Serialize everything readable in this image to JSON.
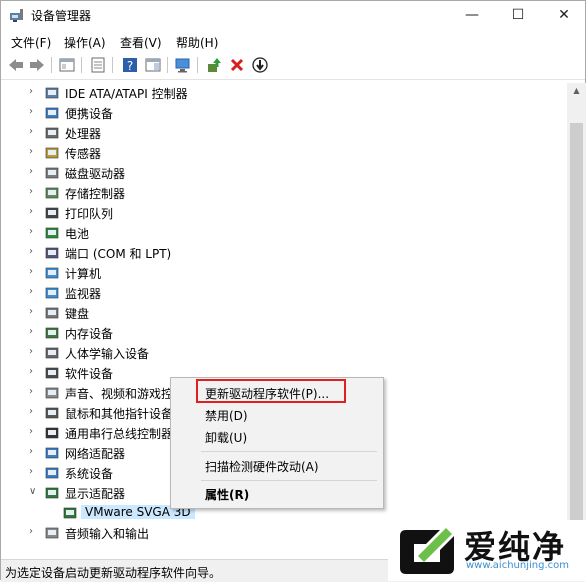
{
  "window": {
    "title": "设备管理器",
    "minimize": "—",
    "maximize": "☐",
    "close": "✕"
  },
  "menu": [
    "文件(F)",
    "操作(A)",
    "查看(V)",
    "帮助(H)"
  ],
  "tree": [
    {
      "label": "IDE ATA/ATAPI 控制器",
      "icon": "ide-controller-icon",
      "expanded": false
    },
    {
      "label": "便携设备",
      "icon": "portable-device-icon",
      "expanded": false
    },
    {
      "label": "处理器",
      "icon": "processor-icon",
      "expanded": false
    },
    {
      "label": "传感器",
      "icon": "sensor-icon",
      "expanded": false
    },
    {
      "label": "磁盘驱动器",
      "icon": "disk-drive-icon",
      "expanded": false
    },
    {
      "label": "存储控制器",
      "icon": "storage-controller-icon",
      "expanded": false
    },
    {
      "label": "打印队列",
      "icon": "printer-icon",
      "expanded": false
    },
    {
      "label": "电池",
      "icon": "battery-icon",
      "expanded": false
    },
    {
      "label": "端口 (COM 和 LPT)",
      "icon": "port-icon",
      "expanded": false
    },
    {
      "label": "计算机",
      "icon": "computer-icon",
      "expanded": false
    },
    {
      "label": "监视器",
      "icon": "monitor-icon",
      "expanded": false
    },
    {
      "label": "键盘",
      "icon": "keyboard-icon",
      "expanded": false
    },
    {
      "label": "内存设备",
      "icon": "memory-icon",
      "expanded": false
    },
    {
      "label": "人体学输入设备",
      "icon": "hid-icon",
      "expanded": false
    },
    {
      "label": "软件设备",
      "icon": "software-device-icon",
      "expanded": false
    },
    {
      "label": "声音、视频和游戏控",
      "icon": "sound-icon",
      "expanded": false
    },
    {
      "label": "鼠标和其他指针设备",
      "icon": "mouse-icon",
      "expanded": false
    },
    {
      "label": "通用串行总线控制器",
      "icon": "usb-icon",
      "expanded": false
    },
    {
      "label": "网络适配器",
      "icon": "network-adapter-icon",
      "expanded": false
    },
    {
      "label": "系统设备",
      "icon": "system-device-icon",
      "expanded": false
    },
    {
      "label": "显示适配器",
      "icon": "display-adapter-icon",
      "expanded": true
    },
    {
      "label": "VMware SVGA 3D",
      "icon": "display-adapter-icon",
      "child": true,
      "selected": true
    },
    {
      "label": "音频输入和输出",
      "icon": "audio-io-icon",
      "expanded": false
    }
  ],
  "context_menu": {
    "update_driver": "更新驱动程序软件(P)...",
    "disable": "禁用(D)",
    "uninstall": "卸载(U)",
    "scan": "扫描检测硬件改动(A)",
    "properties": "属性(R)"
  },
  "status": "为选定设备启动更新驱动程序软件向导。",
  "watermark": {
    "brand": "爱纯净",
    "url": "www.aichunjing.com"
  },
  "colors": {
    "accent": "#0078d7",
    "highlight_border": "#e02020",
    "selected_row": "#cce8ff"
  }
}
